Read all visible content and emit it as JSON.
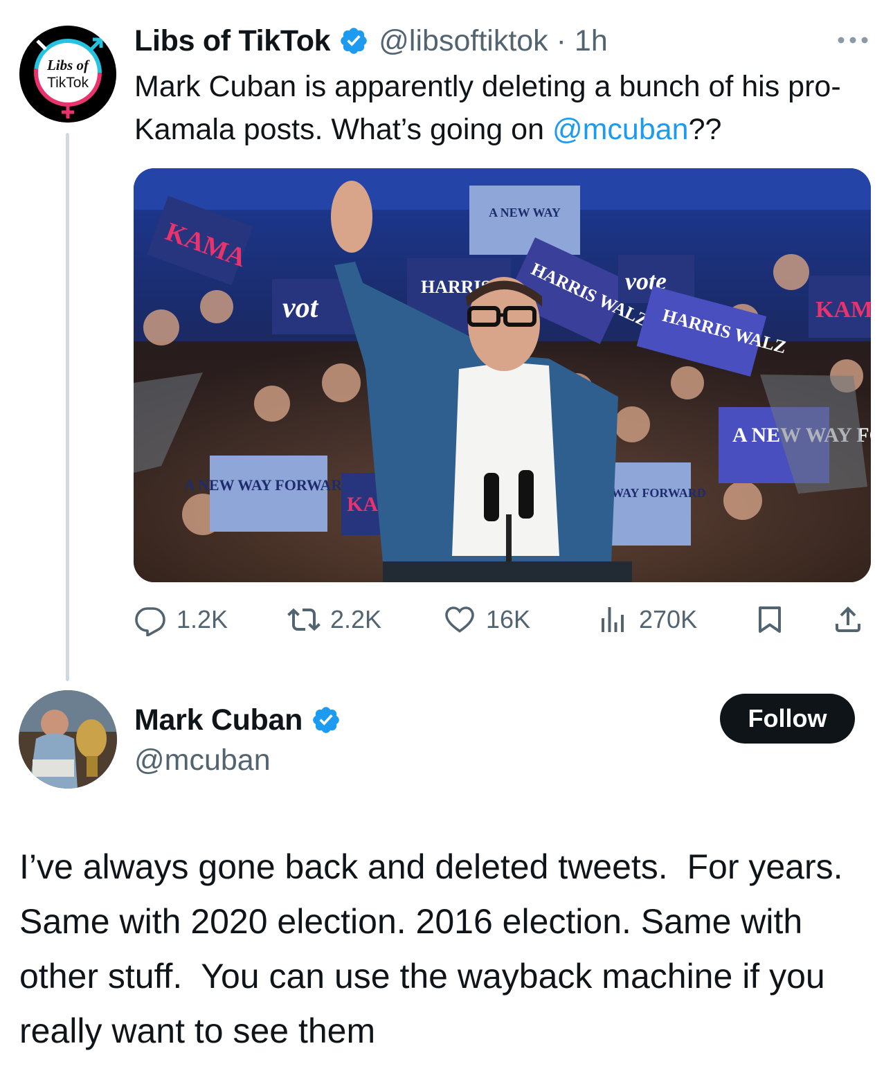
{
  "colors": {
    "text_primary": "#0f1419",
    "text_secondary": "#536471",
    "link": "#1d9bf0",
    "verified_badge": "#1d9bf0",
    "thread_line": "#cfd9de",
    "follow_bg": "#0f1419"
  },
  "tweet": {
    "author": {
      "display_name": "Libs of TikTok",
      "handle": "@libsoftiktok",
      "avatar_text_line1": "Libs of",
      "avatar_text_line2": "TikTok",
      "verified_icon": "verified-badge-icon"
    },
    "time_separator": " · ",
    "time": "1h",
    "more_icon": "more-options-icon",
    "text_main": "Mark Cuban is apparently deleting a bunch of his pro-Kamala posts. What’s going on ",
    "mention": "@mcuban",
    "text_tail": "??",
    "media": {
      "signs": [
        "KAMA",
        "vot",
        "A NEW WAY FORWARD",
        "HARRIS WALZ",
        "vote",
        "HARRIS WALZ",
        "HARRIS WALZ",
        "A NEW WAY FORWARD",
        "NEW WAY FORWARD",
        "KA",
        "KAM"
      ]
    },
    "actions": {
      "reply": {
        "icon": "reply-icon",
        "count": "1.2K"
      },
      "repost": {
        "icon": "repost-icon",
        "count": "2.2K"
      },
      "like": {
        "icon": "heart-icon",
        "count": "16K"
      },
      "views": {
        "icon": "views-chart-icon",
        "count": "270K"
      },
      "bookmark": {
        "icon": "bookmark-icon"
      },
      "share": {
        "icon": "share-icon"
      }
    }
  },
  "reply": {
    "author": {
      "display_name": "Mark Cuban",
      "handle": "@mcuban",
      "verified_icon": "verified-badge-icon"
    },
    "follow_label": "Follow",
    "text": "I’ve always gone back and deleted tweets.  For years.  Same with 2020 election. 2016 election. Same with other stuff.  You can use the wayback machine if you really want to see them"
  }
}
